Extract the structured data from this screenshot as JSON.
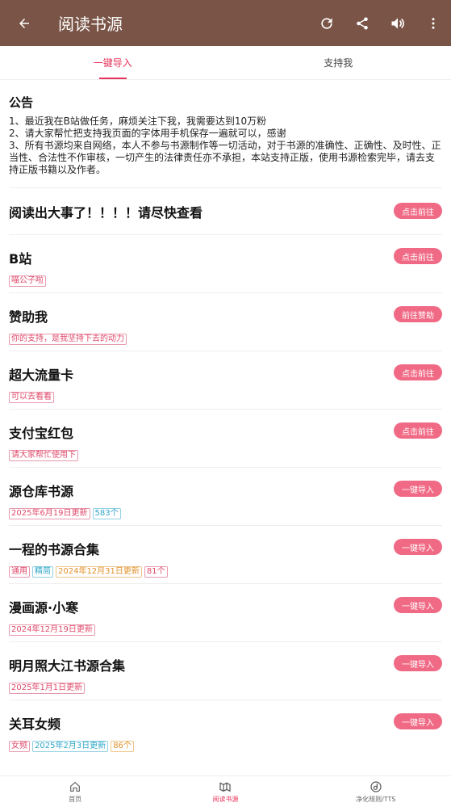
{
  "appbar": {
    "title": "阅读书源",
    "icons": [
      "back-arrow-icon",
      "refresh-icon",
      "share-icon",
      "volume-icon",
      "more-vert-icon"
    ],
    "color": "#7a5547"
  },
  "tabs": [
    {
      "label": "一键导入",
      "active": true
    },
    {
      "label": "支持我",
      "active": false
    }
  ],
  "notice": {
    "title": "公告",
    "lines": [
      "1、最近我在B站做任务，麻烦关注下我，我需要达到10万粉",
      "2、请大家帮忙把支持我页面的字体用手机保存一遍就可以，感谢",
      "3、所有书源均来自网络，本人不参与书源制作等一切活动，对于书源的准确性、正确性、及时性、正当性、合法性不作审核，一切产生的法律责任亦不承担，本站支持正版，使用书源检索完毕，请去支持正版书籍以及作者。"
    ]
  },
  "items": [
    {
      "name": "阅读出大事了！！！！请尽快查看",
      "button": "点击前往",
      "tags": []
    },
    {
      "name": "B站",
      "button": "点击前往",
      "tags": [
        {
          "text": "喵公子啦",
          "color": "red"
        }
      ]
    },
    {
      "name": "赞助我",
      "button": "前往赞助",
      "tags": [
        {
          "text": "你的支持，是我坚持下去的动力",
          "color": "red"
        }
      ]
    },
    {
      "name": "超大流量卡",
      "button": "点击前往",
      "tags": [
        {
          "text": "可以去看看",
          "color": "red"
        }
      ]
    },
    {
      "name": "支付宝红包",
      "button": "点击前往",
      "tags": [
        {
          "text": "请大家帮忙使用下",
          "color": "red"
        }
      ]
    },
    {
      "name": "源仓库书源",
      "button": "一键导入",
      "tags": [
        {
          "text": "2025年6月19日更新",
          "color": "red"
        },
        {
          "text": "583个",
          "color": "blue"
        }
      ]
    },
    {
      "name": "一程的书源合集",
      "button": "一键导入",
      "tags": [
        {
          "text": "通用",
          "color": "red"
        },
        {
          "text": "精简",
          "color": "blue"
        },
        {
          "text": "2024年12月31日更新",
          "color": "orange"
        },
        {
          "text": "81个",
          "color": "red"
        }
      ]
    },
    {
      "name": "漫画源·小寒",
      "button": "一键导入",
      "tags": [
        {
          "text": "2024年12月19日更新",
          "color": "red"
        }
      ]
    },
    {
      "name": "明月照大江书源合集",
      "button": "一键导入",
      "tags": [
        {
          "text": "2025年1月1日更新",
          "color": "red"
        }
      ]
    },
    {
      "name": "关耳女频",
      "button": "一键导入",
      "tags": [
        {
          "text": "女频",
          "color": "red"
        },
        {
          "text": "2025年2月3日更新",
          "color": "blue"
        },
        {
          "text": "86个",
          "color": "orange"
        }
      ]
    }
  ],
  "bottom_nav": [
    {
      "label": "首页",
      "icon": "home-icon",
      "active": false
    },
    {
      "label": "阅读书源",
      "icon": "book-source-icon",
      "active": true
    },
    {
      "label": "净化规则/TTS",
      "icon": "purify-tts-icon",
      "active": false
    }
  ],
  "colors": {
    "accent": "#e8325a",
    "button": "#f06a85"
  }
}
